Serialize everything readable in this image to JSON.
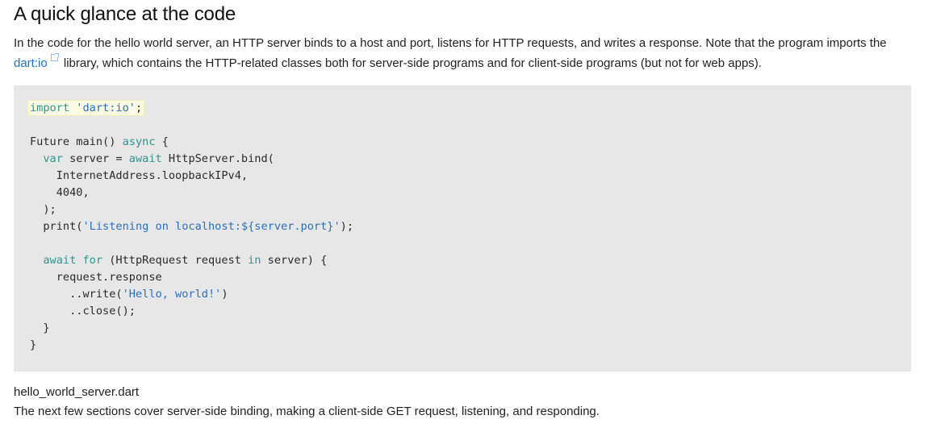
{
  "heading": "A quick glance at the code",
  "intro": {
    "before_link": "In the code for the hello world server, an HTTP server binds to a host and port, listens for HTTP requests, and writes a response. Note that the program imports the ",
    "link_text": "dart:io",
    "after_link": " library, which contains the HTTP-related classes both for server-side programs and for client-side programs (but not for web apps)."
  },
  "code": {
    "l1": {
      "kw": "import",
      "sp": " ",
      "str": "'dart:io'",
      "end": ";"
    },
    "l3": {
      "a": "Future main() ",
      "kw": "async",
      "b": " {"
    },
    "l4": {
      "indent": "  ",
      "kw1": "var",
      "a": " server = ",
      "kw2": "await",
      "b": " HttpServer.bind("
    },
    "l5": "    InternetAddress.loopbackIPv4,",
    "l6": "    4040,",
    "l7": "  );",
    "l8": {
      "a": "  print(",
      "str": "'Listening on localhost:${server.port}'",
      "b": ");"
    },
    "l10": {
      "indent": "  ",
      "kw1": "await",
      "sp": " ",
      "kw2": "for",
      "a": " (HttpRequest request ",
      "kw3": "in",
      "b": " server) {"
    },
    "l11": "    request.response",
    "l12": {
      "a": "      ..write(",
      "str": "'Hello, world!'",
      "b": ")"
    },
    "l13": "      ..close();",
    "l14": "  }",
    "l15": "}"
  },
  "caption": "hello_world_server.dart",
  "next_text": "The next few sections cover server-side binding, making a client-side GET request, listening, and responding.",
  "colors": {
    "link": "#1a73c8",
    "keyword": "#31958e",
    "string": "#2a6fc0",
    "code_background": "#e7e7e7"
  }
}
